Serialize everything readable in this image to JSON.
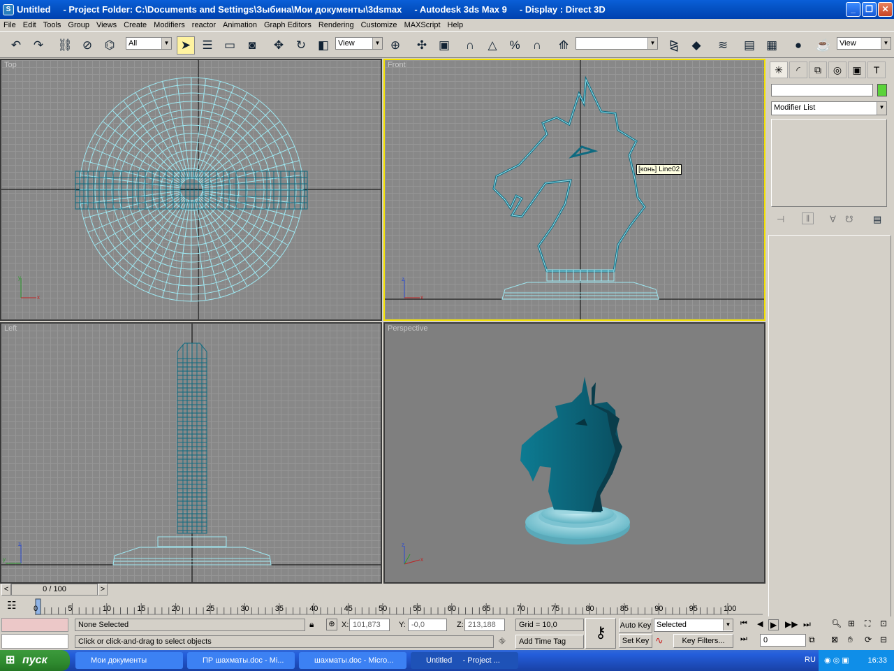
{
  "window": {
    "title": "Untitled     - Project Folder: C:\\Documents and Settings\\Зыбина\\Мои документы\\3dsmax     - Autodesk 3ds Max 9     - Display : Direct 3D"
  },
  "menu": [
    "File",
    "Edit",
    "Tools",
    "Group",
    "Views",
    "Create",
    "Modifiers",
    "reactor",
    "Animation",
    "Graph Editors",
    "Rendering",
    "Customize",
    "MAXScript",
    "Help"
  ],
  "toolbar": {
    "filter": "All",
    "ref_coord": "View",
    "named_sel": "",
    "view_combo": "View"
  },
  "viewports": {
    "top": "Top",
    "front": "Front",
    "left": "Left",
    "perspective": "Perspective",
    "tooltip": "[конь] Line02"
  },
  "panel": {
    "modifier_list": "Modifier List",
    "object_name": ""
  },
  "timeline": {
    "frame": "0 / 100",
    "ticks": [
      "0",
      "5",
      "10",
      "15",
      "20",
      "25",
      "30",
      "35",
      "40",
      "45",
      "50",
      "55",
      "60",
      "65",
      "70",
      "75",
      "80",
      "85",
      "90",
      "95",
      "100"
    ]
  },
  "status": {
    "selection": "None Selected",
    "prompt": "Click or click-and-drag to select objects",
    "x_label": "X:",
    "x": "101,873",
    "y_label": "Y:",
    "y": "-0,0",
    "z_label": "Z:",
    "z": "213,188",
    "grid": "Grid = 10,0",
    "add_time_tag": "Add Time Tag",
    "auto_key": "Auto Key",
    "set_key": "Set Key",
    "key_mode": "Selected",
    "key_filters": "Key Filters...",
    "frame_field": "0"
  },
  "taskbar": {
    "start": "пуск",
    "items": [
      "Мои документы",
      "ПР шахматы.doc - Mi...",
      "шахматы.doc - Micro...",
      "Untitled     - Project ..."
    ],
    "lang": "RU",
    "clock": "16:33"
  },
  "colors": {
    "wire": "#8ee0ec",
    "solid": "#0e6a80",
    "active_border": "#f3e100"
  }
}
